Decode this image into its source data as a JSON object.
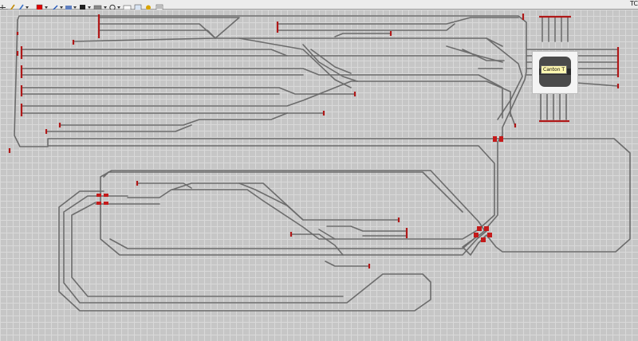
{
  "window": {
    "corner_flag": "TC"
  },
  "toolbar": {
    "tools": [
      {
        "icon": "pointer-cross-icon"
      },
      {
        "icon": "pencil-icon"
      },
      {
        "icon": "pen-icon"
      },
      {
        "icon": "color-red-icon",
        "color": "#e00000"
      },
      {
        "icon": "line-tool-icon"
      },
      {
        "icon": "track-tool-icon"
      },
      {
        "icon": "signal-tool-icon"
      },
      {
        "icon": "block-tool-icon"
      },
      {
        "icon": "turnout-tool-icon"
      },
      {
        "icon": "circle-tool-icon"
      },
      {
        "icon": "text-tool-icon"
      },
      {
        "icon": "image-tool-icon"
      },
      {
        "icon": "route-tool-icon"
      },
      {
        "icon": "settings-tool-icon"
      }
    ]
  },
  "turntable": {
    "label": "Canton T"
  },
  "colors": {
    "track": "#6c6c6c",
    "buffer": "#b01818",
    "signal": "#c41a1a",
    "grid_line": "#d9d9d9",
    "grid_bg": "#c6c6c6"
  }
}
